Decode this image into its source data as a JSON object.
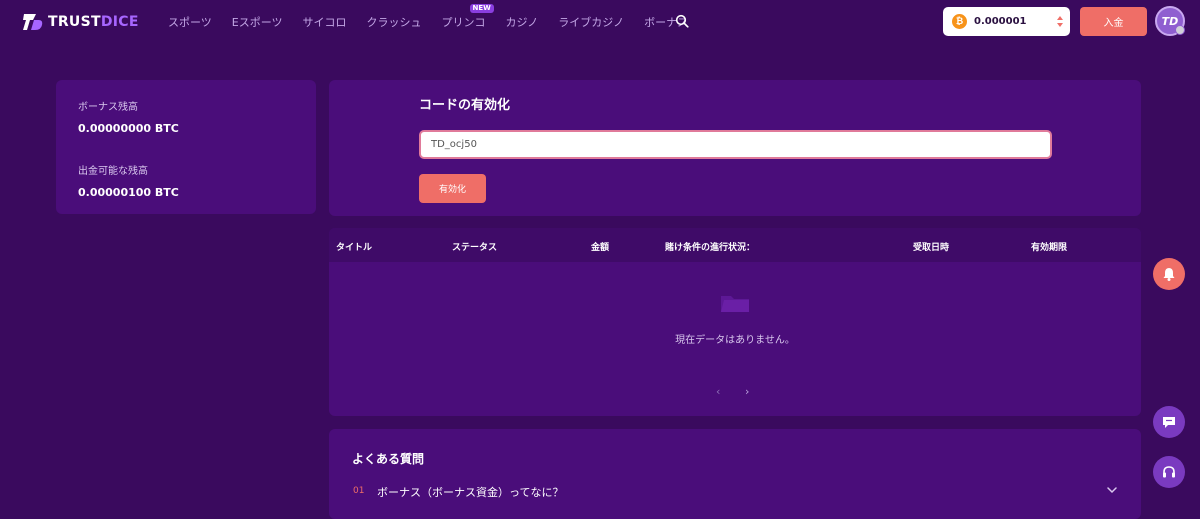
{
  "brand": {
    "name_a": "TRUST",
    "name_b": "DICE",
    "accent": "#a766ff"
  },
  "nav": {
    "items": [
      "スポーツ",
      "Eスポーツ",
      "サイコロ",
      "クラッシュ",
      "プリンコ",
      "カジノ",
      "ライブカジノ",
      "ボーナス"
    ],
    "badge": "NEW",
    "search_icon": "search-icon"
  },
  "header": {
    "balance": "0.000001",
    "currency_icon": "bitcoin-icon",
    "deposit_label": "入金",
    "avatar_text": "TD"
  },
  "bonus": {
    "bonus_balance_label": "ボーナス残高",
    "bonus_balance_value": "0.00000000 BTC",
    "withdrawable_label": "出金可能な残高",
    "withdrawable_value": "0.00000100 BTC"
  },
  "code": {
    "title": "コードの有効化",
    "input_value": "TD_ocj50",
    "activate_label": "有効化"
  },
  "table": {
    "columns": [
      "タイトル",
      "ステータス",
      "金額",
      "賭け条件の進行状況：",
      "受取日時",
      "有効期限"
    ],
    "empty_text": "現在データはありません。",
    "prev_glyph": "‹",
    "next_glyph": "›"
  },
  "faq": {
    "title": "よくある質問",
    "items": [
      {
        "number": "01",
        "question": "ボーナス（ボーナス資金）ってなに？"
      }
    ]
  },
  "colors": {
    "background": "#3a0a5e",
    "panel": "#4a0d7a",
    "button": "#ef6e67"
  }
}
